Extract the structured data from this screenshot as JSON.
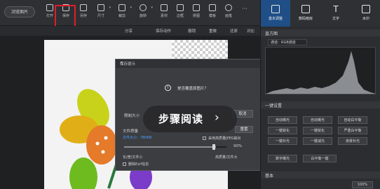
{
  "toolbar": {
    "open_label": "浏览图片",
    "items": [
      {
        "label": "打开",
        "icon": "folder-icon"
      },
      {
        "label": "保存",
        "icon": "save-icon"
      },
      {
        "label": "另存",
        "icon": "save-as-icon"
      },
      {
        "label": "尺寸",
        "icon": "resize-icon"
      },
      {
        "label": "裁剪",
        "icon": "crop-icon"
      },
      {
        "label": "旋转",
        "icon": "rotate-icon"
      },
      {
        "label": "素材",
        "icon": "material-icon"
      },
      {
        "label": "边框",
        "icon": "frame-icon"
      },
      {
        "label": "拼图",
        "icon": "puzzle-icon"
      },
      {
        "label": "模板",
        "icon": "template-icon"
      },
      {
        "label": "画笔",
        "icon": "brush-icon"
      }
    ],
    "more": "···"
  },
  "subbar": {
    "share": "分享",
    "save_action": "保存动作",
    "undo": "撤销",
    "redo": "重做",
    "restore": "还原",
    "compare": "对比"
  },
  "dialog": {
    "title": "保存提示",
    "question": "是否覆盖原图片？",
    "limit_size": "限制大小",
    "cancel": "取消",
    "file_quality": "文件质量",
    "file_size": "文件大小：780KB",
    "quality_pct": "90%",
    "reset": "重置",
    "progressive": "采用高质量JPEG输出",
    "dims_left": "长/宽/文件小",
    "dims_right": "高质量/文件大",
    "keep_exif": "删除Exif信息"
  },
  "overlay": {
    "text": "步骤阅读",
    "arrow": "›"
  },
  "right_panel": {
    "tabs": [
      {
        "label": "基本调整",
        "icon": "adjust-icon"
      },
      {
        "label": "数码暗房",
        "icon": "camera-icon"
      },
      {
        "label": "文字",
        "icon": "text-icon"
      },
      {
        "label": "水印",
        "icon": "watermark-icon"
      }
    ],
    "histogram_title": "直方图",
    "histogram_channel": "通道：RGB通道",
    "onekey_title": "一键设置",
    "onekey_buttons": [
      "自动曝光",
      "自动曝光",
      "自动白平衡",
      "一键锐化",
      "一键锐化",
      "严重白平衡",
      "一键补光",
      "一键减光",
      "夜景补光",
      "数字曝光",
      "白平衡一键"
    ],
    "basic_title": "基本",
    "percent": "100%"
  },
  "colors": {
    "highlight": "#e11d2a",
    "active_tab": "#1f4f86"
  }
}
